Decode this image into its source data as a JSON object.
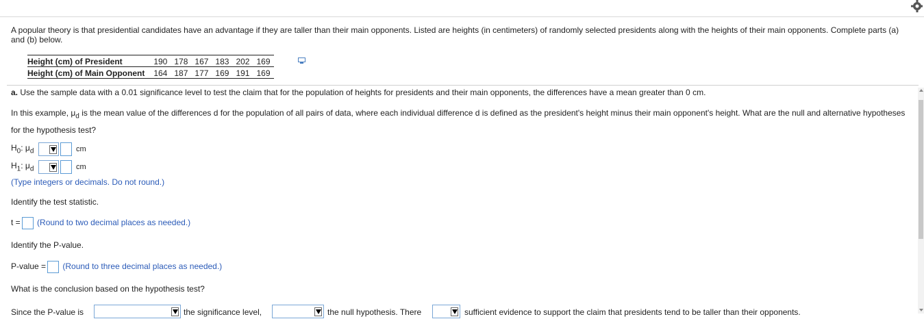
{
  "intro": "A popular theory is that presidential candidates have an advantage if they are taller than their main opponents. Listed are heights (in centimeters) of randomly selected presidents along with the heights of their main opponents. Complete parts (a) and (b) below.",
  "table": {
    "row1_label": "Height (cm) of President",
    "row1": [
      "190",
      "178",
      "167",
      "183",
      "202",
      "169"
    ],
    "row2_label": "Height (cm) of Main Opponent",
    "row2": [
      "164",
      "187",
      "177",
      "169",
      "191",
      "169"
    ]
  },
  "part_a": {
    "label": "a.",
    "text": "Use the sample data with a 0.01 significance level to test the claim that for the population of heights for presidents and their main opponents, the differences have a mean greater than 0 cm."
  },
  "example": {
    "pre": "In this example, ",
    "mu": "μ",
    "sub": "d",
    "post": " is the mean value of the differences d for the population of all pairs of data, where each individual difference d is defined as the president's height minus their main opponent's height. What are the null and alternative hypotheses for the hypothesis test?"
  },
  "hypotheses": {
    "h0_label": "H",
    "h0_sub": "0",
    "h1_label": "H",
    "h1_sub": "1",
    "mu": "μ",
    "mu_sub": "d",
    "unit": "cm",
    "hint": "(Type integers or decimals. Do not round.)"
  },
  "test_stat": {
    "prompt": "Identify the test statistic.",
    "label": "t =",
    "hint": "(Round to two decimal places as needed.)"
  },
  "p_value": {
    "prompt": "Identify the P-value.",
    "label": "P-value =",
    "hint": "(Round to three decimal places as needed.)"
  },
  "conclusion": {
    "prompt": "What is the conclusion based on the hypothesis test?",
    "part1": "Since the P-value is",
    "part2": "the significance level,",
    "part3": "the null hypothesis. There",
    "part4": "sufficient evidence to support the claim that presidents tend to be taller than their opponents."
  },
  "icons": [
    "gear-icon",
    "copy-table-icon",
    "dropdown-arrow-icon"
  ]
}
